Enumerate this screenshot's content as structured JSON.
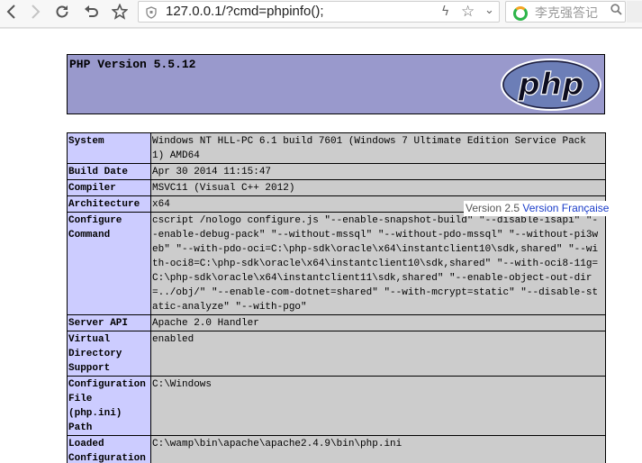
{
  "browser": {
    "url": "127.0.0.1/?cmd=phpinfo();",
    "search_placeholder": "李克强答记",
    "icons": {
      "back": "back-arrow-icon",
      "forward": "forward-arrow-icon",
      "reload": "reload-icon",
      "undo": "undo-icon",
      "bookmark": "star-icon",
      "shield": "shield-icon",
      "lightning": "lightning-icon",
      "favorite": "star-icon",
      "dropdown": "chevron-down-icon",
      "search_engine": "search-engine-logo-icon",
      "search": "magnifier-icon"
    }
  },
  "page": {
    "header_title": "PHP Version 5.5.12",
    "logo_text": "php",
    "rows": [
      {
        "key": "System",
        "value": "Windows NT HLL-PC 6.1 build 7601 (Windows 7 Ultimate Edition Service Pack 1) AMD64"
      },
      {
        "key": "Build Date",
        "value": "Apr 30 2014 11:15:47"
      },
      {
        "key": "Compiler",
        "value": "MSVC11 (Visual C++ 2012)"
      },
      {
        "key": "Architecture",
        "value": "x64"
      },
      {
        "key": "Configure Command",
        "value": "cscript /nologo configure.js \"--enable-snapshot-build\" \"--disable-isapi\" \"--enable-debug-pack\" \"--without-mssql\" \"--without-pdo-mssql\" \"--without-pi3web\" \"--with-pdo-oci=C:\\php-sdk\\oracle\\x64\\instantclient10\\sdk,shared\" \"--with-oci8=C:\\php-sdk\\oracle\\x64\\instantclient10\\sdk,shared\" \"--with-oci8-11g=C:\\php-sdk\\oracle\\x64\\instantclient11\\sdk,shared\" \"--enable-object-out-dir=../obj/\" \"--enable-com-dotnet=shared\" \"--with-mcrypt=static\" \"--disable-static-analyze\" \"--with-pgo\""
      },
      {
        "key": "Server API",
        "value": "Apache 2.0 Handler"
      },
      {
        "key": "Virtual Directory Support",
        "value": "enabled"
      },
      {
        "key": "Configuration File (php.ini) Path",
        "value": "C:\\Windows"
      },
      {
        "key": "Loaded Configuration File",
        "value": "C:\\wamp\\bin\\apache\\apache2.4.9\\bin\\php.ini"
      }
    ],
    "tooltip": {
      "version": "Version 2.5",
      "link": "Version Française"
    }
  },
  "colors": {
    "header_bg": "#9999cc",
    "key_bg": "#ccccff",
    "value_bg": "#cccccc",
    "link": "#1a3cc9"
  }
}
